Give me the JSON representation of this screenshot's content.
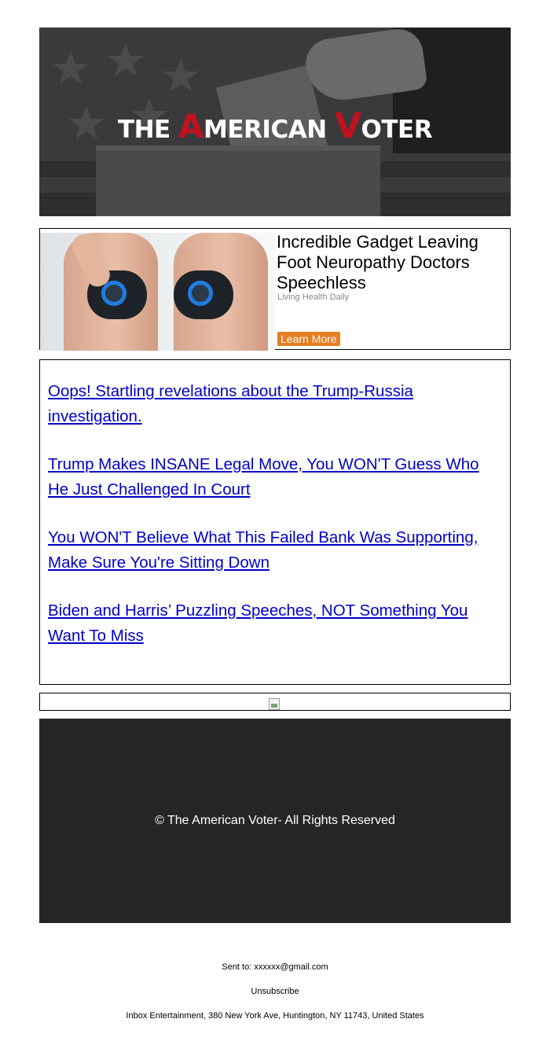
{
  "header": {
    "brand_the": "THE",
    "brand_a": "A",
    "brand_merican": "MERICAN",
    "brand_v": "V",
    "brand_oter": "OTER"
  },
  "ad": {
    "title": "Incredible Gadget Leaving Foot Neuropathy Doctors Speechless",
    "source": "Living Health Daily",
    "button_label": "Learn More",
    "button_color": "#e67e22"
  },
  "links": [
    {
      "text": "Oops! Startling revelations about the Trump-Russia investigation."
    },
    {
      "text": "Trump Makes INSANE Legal Move, You WON'T Guess Who He Just Challenged In Court"
    },
    {
      "text": "You WON'T Believe What This Failed Bank Was Supporting, Make Sure You're Sitting Down"
    },
    {
      "text": "Biden and Harris’ Puzzling Speeches, NOT Something You Want To Miss"
    }
  ],
  "footer": {
    "copyright": "© The American Voter- All Rights Reserved",
    "sent_to": "Sent to: xxxxxx@gmail.com",
    "unsubscribe": "Unsubscribe",
    "address": "Inbox Entertainment, 380 New York Ave, Huntington, NY 11743, United States"
  },
  "colors": {
    "link": "#0000cc",
    "brand_red": "#c1121f",
    "footer_bg": "#262626"
  }
}
